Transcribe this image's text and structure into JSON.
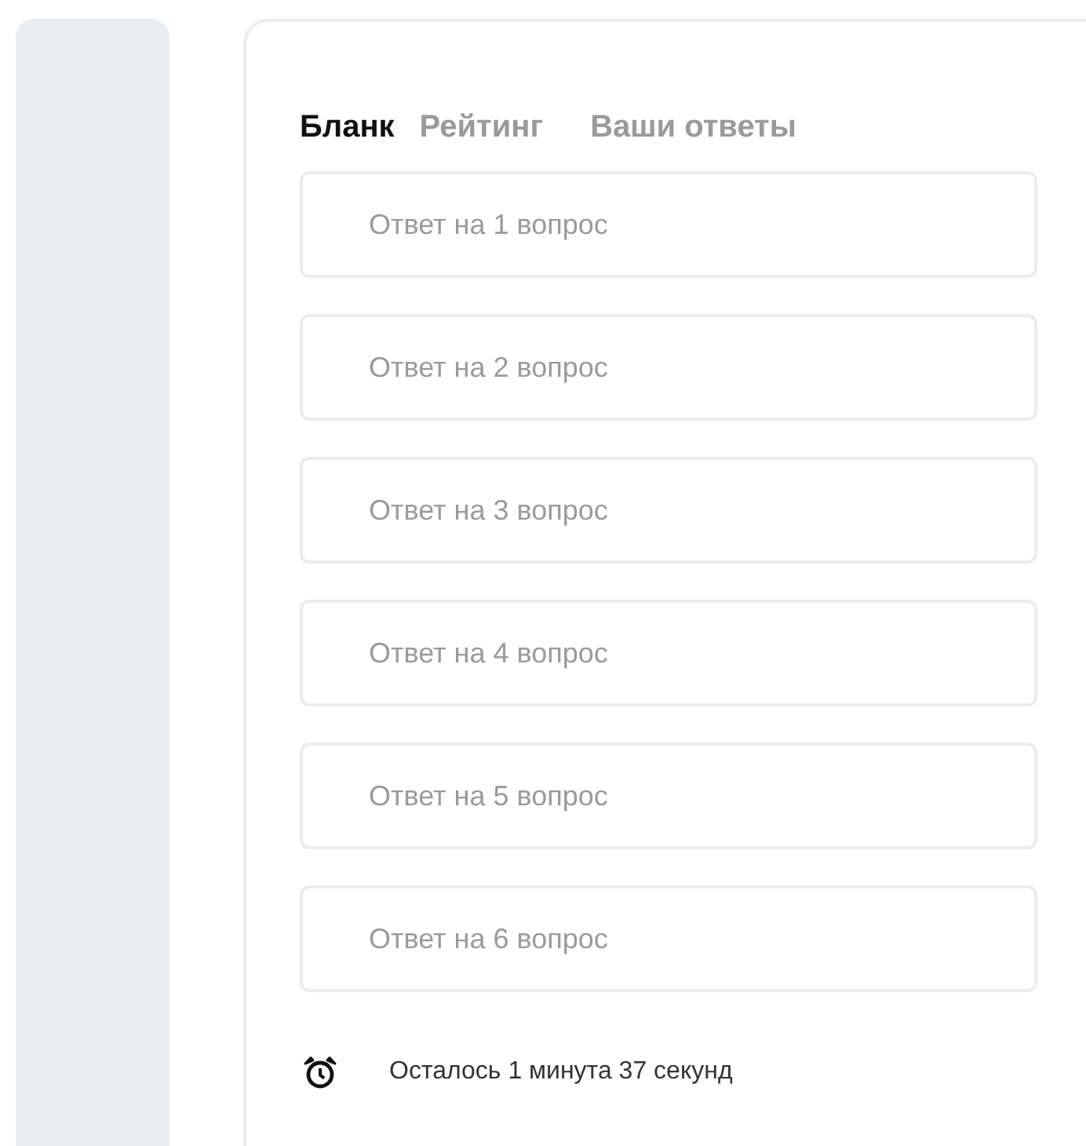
{
  "tabs": [
    {
      "label": "Бланк",
      "selected": true
    },
    {
      "label": "Рейтинг",
      "selected": false
    },
    {
      "label": "Ваши ответы",
      "selected": false
    }
  ],
  "answers": [
    {
      "placeholder": "Ответ на 1 вопрос"
    },
    {
      "placeholder": "Ответ на 2 вопрос"
    },
    {
      "placeholder": "Ответ на 3 вопрос"
    },
    {
      "placeholder": "Ответ на 4 вопрос"
    },
    {
      "placeholder": "Ответ на 5 вопрос"
    },
    {
      "placeholder": "Ответ на 6 вопрос"
    }
  ],
  "timer": {
    "text": "Осталось 1 минута 37 секунд"
  }
}
